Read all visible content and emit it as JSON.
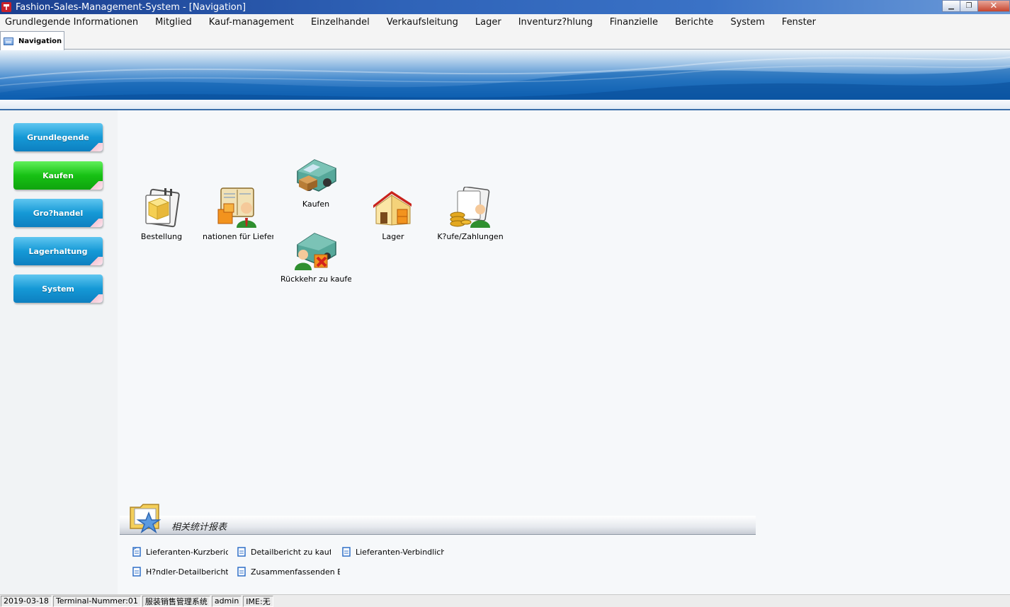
{
  "window": {
    "title": "Fashion-Sales-Management-System - [Navigation]",
    "minimize": "▁",
    "maximize": "❐",
    "close": "✕"
  },
  "menu": [
    "Grundlegende Informationen",
    "Mitglied",
    "Kauf-management",
    "Einzelhandel",
    "Verkaufsleitung",
    "Lager",
    "Inventurz?hlung",
    "Finanzielle",
    "Berichte",
    "System",
    "Fenster"
  ],
  "tab": {
    "label": "Navigation",
    "icon": "window-list-icon"
  },
  "sidebar": [
    {
      "label": "Grundlegende",
      "color": "#1599d6"
    },
    {
      "label": "Kaufen",
      "color": "#17c114",
      "active": true
    },
    {
      "label": "Gro?handel",
      "color": "#1599d6"
    },
    {
      "label": "Lagerhaltung",
      "color": "#1599d6"
    },
    {
      "label": "System",
      "color": "#1599d6"
    }
  ],
  "functions": [
    {
      "label": "Bestellung",
      "icon": "order-clipboard-icon"
    },
    {
      "label": "nationen für Liefer",
      "icon": "supplier-book-icon"
    },
    {
      "label": "Kaufen",
      "icon": "purchase-truck-icon"
    },
    {
      "label": "Rückkehr zu kaufer",
      "icon": "purchase-return-icon"
    },
    {
      "label": "Lager",
      "icon": "warehouse-house-icon"
    },
    {
      "label": "K?ufe/Zahlungen",
      "icon": "payment-coins-icon"
    }
  ],
  "reports": {
    "title": "相关统计报表",
    "links": [
      "Lieferanten-Kurzbericht",
      "Detailbericht zu kaufen",
      "Lieferanten-Verbindlichkeit",
      "H?ndler-Detailbericht",
      "Zusammenfassenden Beric"
    ]
  },
  "status": [
    "2019-03-18",
    "Terminal-Nummer:01",
    "服装销售管理系统",
    "admin",
    "IME:无"
  ]
}
